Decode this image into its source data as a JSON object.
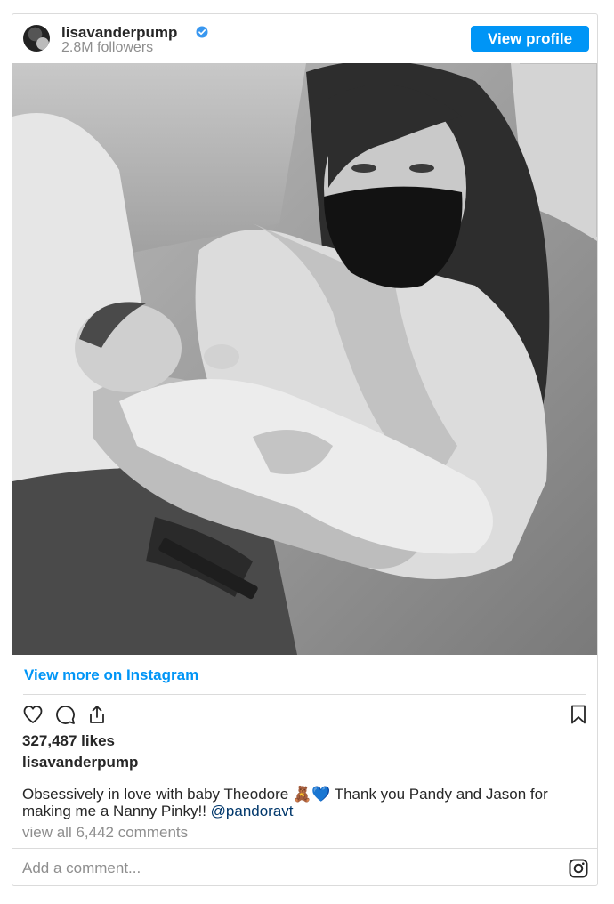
{
  "header": {
    "username": "lisavanderpump",
    "followers": "2.8M followers",
    "view_profile_label": "View profile",
    "verified_icon": "verified-badge-icon"
  },
  "post": {
    "image_alt": "Photo by lisavanderpump",
    "view_more_label": "View more on Instagram",
    "likes": "327,487 likes",
    "owner": "lisavanderpump",
    "caption_text": "Obsessively in love with baby Theodore 🧸💙 Thank you Pandy and Jason for making me a Nanny Pinky!!",
    "caption_mention": "@pandoravt",
    "comments_link": "view all 6,442 comments",
    "add_comment_placeholder": "Add a comment..."
  },
  "icons": {
    "like": "heart-icon",
    "comment": "comment-icon",
    "share": "share-icon",
    "save": "bookmark-icon",
    "instagram": "instagram-icon"
  },
  "colors": {
    "accent": "#0095f6",
    "mention": "#00376b",
    "muted": "#8e8e8e",
    "border": "#dbdbdb"
  }
}
